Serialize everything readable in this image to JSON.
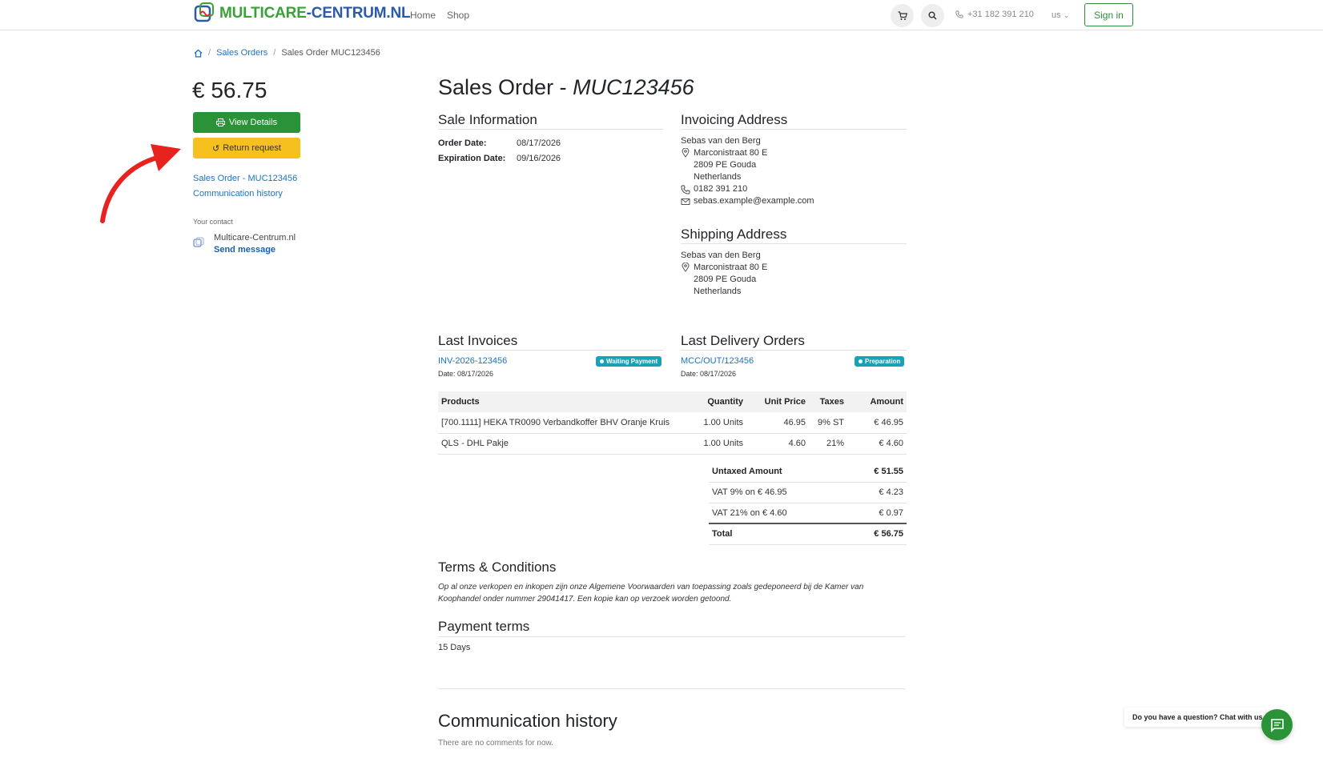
{
  "header": {
    "brand_part1": "MULTICARE",
    "brand_part2": "-CENTRUM.NL",
    "nav": [
      "Home",
      "Shop"
    ],
    "phone": "+31 182 391 210",
    "language": "us",
    "sign_in": "Sign in"
  },
  "breadcrumb": {
    "sales_orders": "Sales Orders",
    "current": "Sales Order MUC123456"
  },
  "sidebar": {
    "price": "€ 56.75",
    "view_details": "View Details",
    "return_request": "Return request",
    "link_order": "Sales Order - MUC123456",
    "link_history": "Communication history",
    "your_contact": "Your contact",
    "contact_name": "Multicare-Centrum.nl",
    "send_message": "Send message"
  },
  "order": {
    "title_prefix": "Sales Order - ",
    "title_number": "MUC123456",
    "sale_information": "Sale Information",
    "order_date_label": "Order Date:",
    "order_date": "08/17/2026",
    "expiration_date_label": "Expiration Date:",
    "expiration_date": "09/16/2026"
  },
  "invoicing": {
    "title": "Invoicing Address",
    "name": "Sebas van den Berg",
    "street": "Marconistraat 80 E",
    "city": "2809 PE Gouda",
    "country": "Netherlands",
    "phone": "0182 391 210",
    "email": "sebas.example@example.com"
  },
  "shipping": {
    "title": "Shipping Address",
    "name": "Sebas van den Berg",
    "street": "Marconistraat 80 E",
    "city": "2809 PE Gouda",
    "country": "Netherlands"
  },
  "invoices": {
    "title": "Last Invoices",
    "ref": "INV-2026-123456",
    "badge": "Waiting Payment",
    "date": "Date: 08/17/2026"
  },
  "deliveries": {
    "title": "Last Delivery Orders",
    "ref": "MCC/OUT/123456",
    "badge": "Preparation",
    "date": "Date: 08/17/2026"
  },
  "products": {
    "headers": [
      "Products",
      "Quantity",
      "Unit Price",
      "Taxes",
      "Amount"
    ],
    "rows": [
      [
        "[700.1111] HEKA TR0090 Verbandkoffer BHV Oranje Kruis",
        "1.00 Units",
        "46.95",
        "9% ST",
        "€ 46.95"
      ],
      [
        "QLS - DHL Pakje",
        "1.00 Units",
        "4.60",
        "21%",
        "€ 4.60"
      ]
    ]
  },
  "totals": {
    "untaxed_label": "Untaxed Amount",
    "untaxed": "€ 51.55",
    "vat9_label": "VAT 9% on € 46.95",
    "vat9": "€ 4.23",
    "vat21_label": "VAT 21% on € 4.60",
    "vat21": "€ 0.97",
    "total_label": "Total",
    "total": "€ 56.75"
  },
  "terms": {
    "title": "Terms & Conditions",
    "text": "Op al onze verkopen en inkopen zijn onze Algemene Voorwaarden van toepassing zoals gedeponeerd bij de Kamer van Koophandel onder nummer 29041417. Een kopie kan op verzoek worden getoond."
  },
  "payment": {
    "title": "Payment terms",
    "value": "15 Days"
  },
  "communication": {
    "title": "Communication history",
    "empty": "There are no comments for now."
  },
  "chat": {
    "label": "Do you have a question? Chat with us."
  },
  "colors": {
    "primary_green": "#2a9338",
    "warning_yellow": "#f6c01e",
    "link_blue": "#1a73c8",
    "badge_teal": "#17a2b8",
    "annotation_red": "#e8231f"
  }
}
